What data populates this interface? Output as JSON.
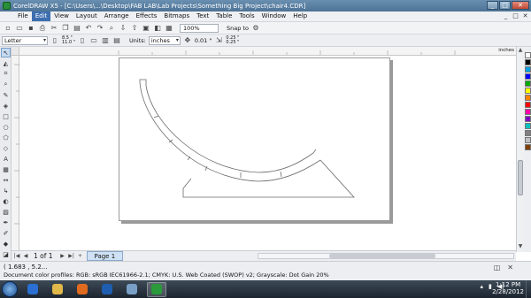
{
  "window": {
    "title": "CorelDRAW X5 - [C:\\Users\\...\\Desktop\\FAB LAB\\Lab Projects\\Something Big Project\\chair4.CDR]",
    "controls": [
      "_",
      "□",
      "✕"
    ]
  },
  "menu": {
    "items": [
      "File",
      "Edit",
      "View",
      "Layout",
      "Arrange",
      "Effects",
      "Bitmaps",
      "Text",
      "Table",
      "Tools",
      "Window",
      "Help"
    ],
    "active": "Edit",
    "doc_controls": [
      "_",
      "□",
      "✕"
    ]
  },
  "toolbar": {
    "zoom": "100%",
    "snap_to": "Snap to"
  },
  "property_bar": {
    "paper_size": "Letter",
    "width": "8.5 \"",
    "height": "11.0 \"",
    "units_label": "Units:",
    "units_value": "inches",
    "nudge": "0.01 \"",
    "dup_x": "0.25 \"",
    "dup_y": "0.25 \""
  },
  "ruler": {
    "units": "inches"
  },
  "page_nav": {
    "count": "1 of 1",
    "tab": "Page 1"
  },
  "status": {
    "coords": "( 1.683 , 5.2...",
    "color_profiles": "Document color profiles: RGB: sRGB IEC61966-2.1; CMYK: U.S. Web Coated (SWOP) v2; Grayscale: Dot Gain 20%"
  },
  "palette": {
    "colors": [
      "#ffffff",
      "#000000",
      "#00a0e0",
      "#0000ff",
      "#00aa00",
      "#ffff00",
      "#ff8000",
      "#ff0000",
      "#ff00aa",
      "#8000c0",
      "#00c0c0",
      "#808080",
      "#c0c0c0",
      "#804000"
    ]
  },
  "taskbar": {
    "time": "1:12 PM",
    "date": "2/28/2012",
    "apps": [
      {
        "name": "ie",
        "color": "#2a6fd1"
      },
      {
        "name": "explorer",
        "color": "#e0b84a"
      },
      {
        "name": "firefox",
        "color": "#e06a1e"
      },
      {
        "name": "media",
        "color": "#1f5db0"
      },
      {
        "name": "photos",
        "color": "#7aa0c8"
      },
      {
        "name": "coreldraw",
        "color": "#2a9a3a",
        "active": true
      }
    ]
  }
}
